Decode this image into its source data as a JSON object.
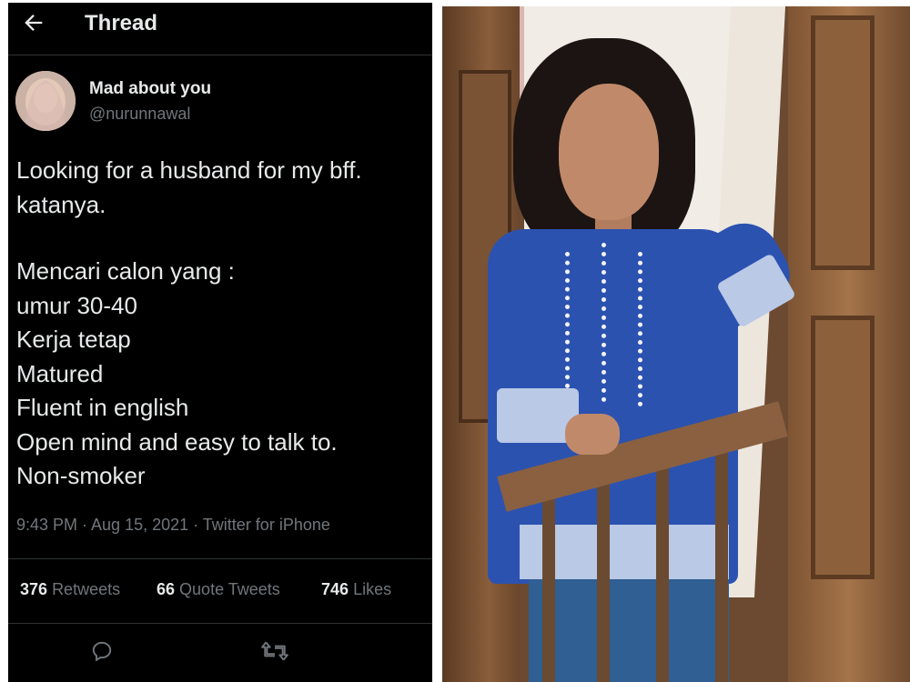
{
  "header": {
    "title": "Thread",
    "back_icon": "arrow-left-icon"
  },
  "author": {
    "display_name": "Mad about you",
    "handle": "@nurunnawal"
  },
  "tweet": {
    "lines": [
      "Looking for a husband for my bff.",
      "katanya.",
      "",
      "Mencari calon yang :",
      "umur 30-40",
      "Kerja tetap",
      "Matured",
      "Fluent in english",
      "Open mind and easy to talk to.",
      "Non-smoker"
    ],
    "meta": "9:43 PM · Aug 15, 2021 · Twitter for iPhone"
  },
  "stats": {
    "retweets_count": "376",
    "retweets_label": "Retweets",
    "quotes_count": "66",
    "quotes_label": "Quote Tweets",
    "likes_count": "746",
    "likes_label": "Likes"
  },
  "actions": {
    "reply_icon": "reply-icon",
    "retweet_icon": "retweet-icon"
  },
  "colors": {
    "background": "#000000",
    "text": "#e7e9ea",
    "secondary": "#71767b",
    "divider": "#2f3336"
  }
}
